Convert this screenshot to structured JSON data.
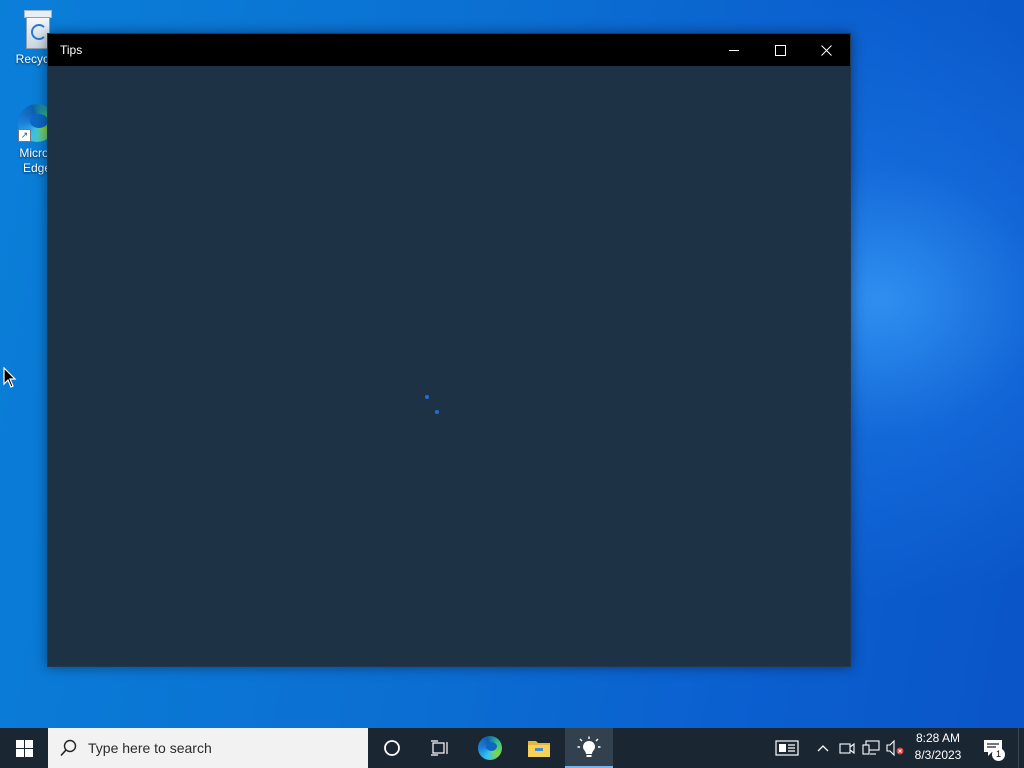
{
  "desktop": {
    "icons": [
      {
        "label": "Recycle"
      },
      {
        "label": "Micros\nEdge"
      }
    ]
  },
  "window": {
    "title": "Tips",
    "background": "#1e3246",
    "controls": {
      "minimize": "minimize-icon",
      "maximize": "maximize-icon",
      "close": "close-icon"
    },
    "loading_indicator": "spinner-dots"
  },
  "taskbar": {
    "search_placeholder": "Type here to search",
    "pinned": [
      "cortana-icon",
      "task-view-icon",
      "edge-icon",
      "file-explorer-icon",
      "tips-lightbulb-icon"
    ],
    "active_app": "Tips",
    "clock": {
      "time": "8:28 AM",
      "date": "8/3/2023"
    },
    "notification_count": "1",
    "accent": "#7ab4ef"
  }
}
